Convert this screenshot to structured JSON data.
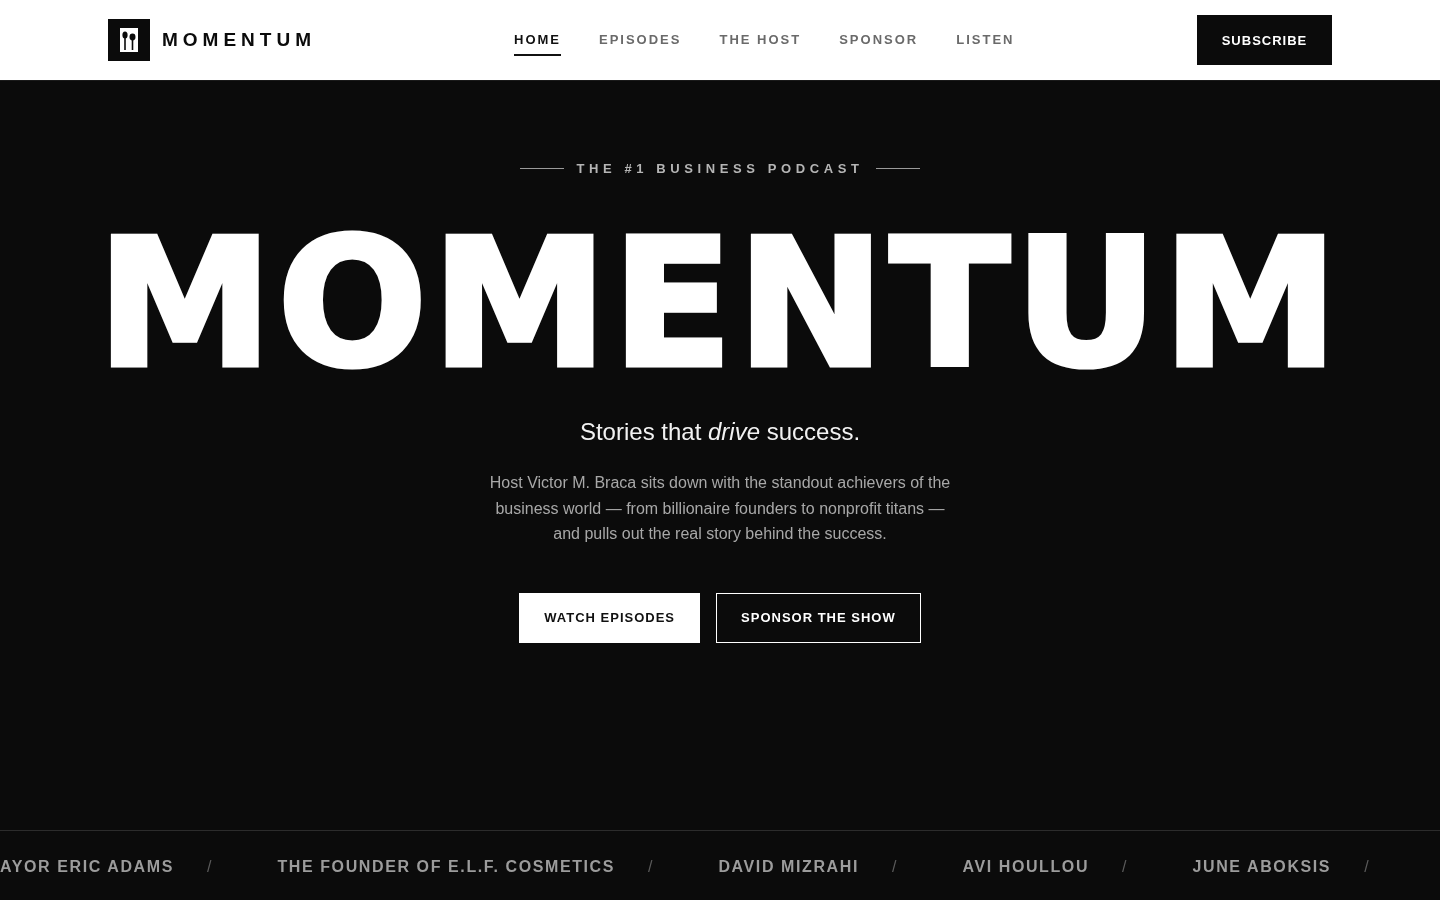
{
  "header": {
    "brand": "MOMENTUM",
    "nav": [
      {
        "label": "HOME",
        "selected": true
      },
      {
        "label": "EPISODES",
        "selected": false
      },
      {
        "label": "THE HOST",
        "selected": false
      },
      {
        "label": "SPONSOR",
        "selected": false
      },
      {
        "label": "LISTEN",
        "selected": false
      }
    ],
    "subscribe_button": "SUBSCRIBE"
  },
  "hero": {
    "eyebrow": "THE #1 BUSINESS PODCAST",
    "title": "MOMENTUM",
    "tagline": "Stories that *drive* success.",
    "description": "Host Victor M. Braca sits down with the standout achievers of the business world — from billionaire founders to nonprofit titans — and pulls out the real story behind the success.",
    "buttons": [
      {
        "label": "WATCH EPISODES",
        "kind": "primary"
      },
      {
        "label": "SPONSOR THE SHOW",
        "kind": "outline"
      }
    ]
  },
  "guest_ticker": [
    {
      "name": "AYOR ERIC ADAMS",
      "separator": "/"
    },
    {
      "name": "THE FOUNDER OF E.L.F. COSMETICS",
      "separator": "/"
    },
    {
      "name": "DAVID MIZRAHI",
      "separator": "/"
    },
    {
      "name": "AVI HOULLOU",
      "separator": "/"
    },
    {
      "name": "JUNE ABOKSIS",
      "separator": "/"
    }
  ]
}
